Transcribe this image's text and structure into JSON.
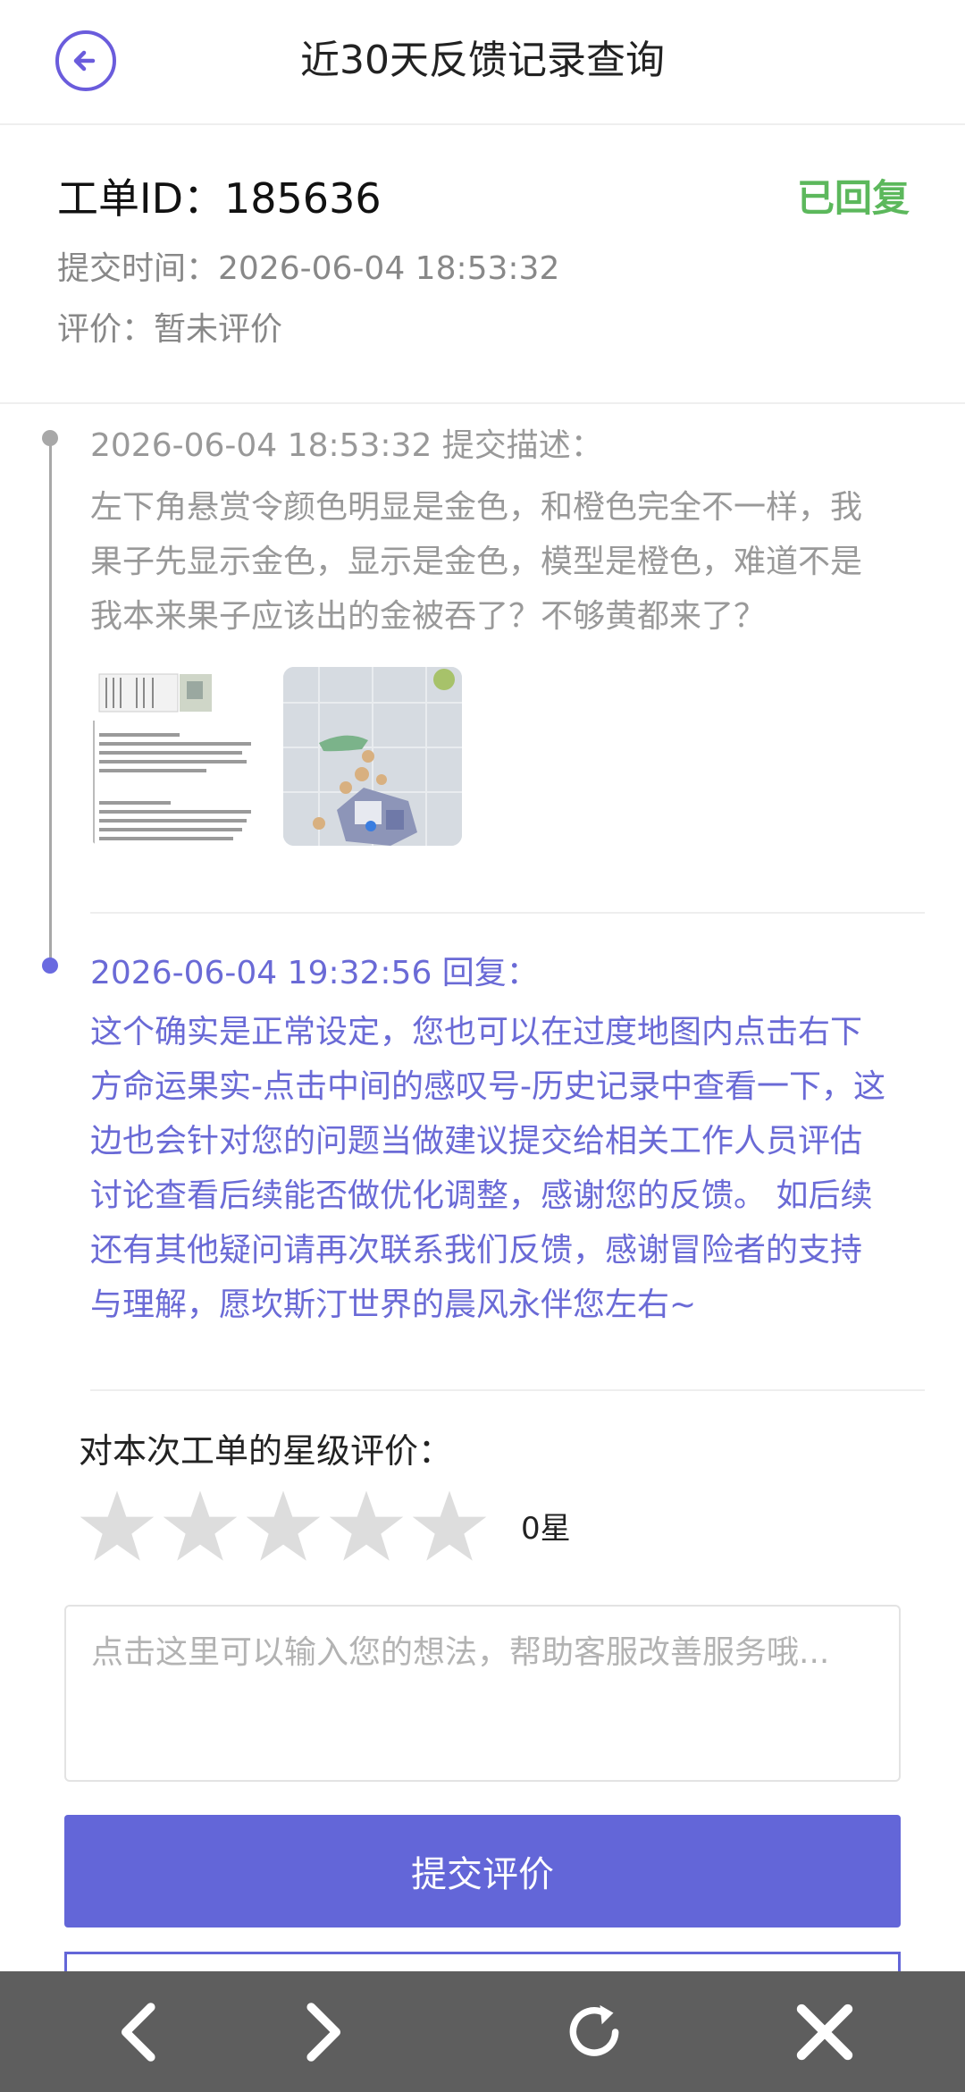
{
  "header": {
    "title": "近30天反馈记录查询"
  },
  "ticket": {
    "id_label": "工单ID：",
    "id_value": "185636",
    "status": "已回复",
    "time_label": "提交时间：",
    "time_value": "2026-06-04 18:53:32",
    "rating_label": "评价：",
    "rating_value": "暂未评价"
  },
  "timeline": {
    "submit": {
      "head": "2026-06-04 18:53:32 提交描述：",
      "lines": [
        "左下角悬赏令颜色明显是金色，和橙色完全不一样，我",
        "果子先显示金色，显示是金色，模型是橙色，难道不是",
        "我本来果子应该出的金被吞了？不够黄都来了？"
      ]
    },
    "reply": {
      "head": "2026-06-04 19:32:56 回复：",
      "lines": [
        "这个确实是正常设定，您也可以在过度地图内点击右下",
        "方命运果实-点击中间的感叹号-历史记录中查看一下，这",
        "边也会针对您的问题当做建议提交给相关工作人员评估",
        "讨论查看后续能否做优化调整，感谢您的反馈。 如后续",
        "还有其他疑问请再次联系我们反馈，感谢冒险者的支持",
        "与理解，愿坎斯汀世界的晨风永伴您左右~"
      ]
    }
  },
  "rating": {
    "label": "对本次工单的星级评价：",
    "stars": 0,
    "max_stars": 5,
    "count_text": "0星",
    "star_color": "#dddddd"
  },
  "feedback": {
    "placeholder": "点击这里可以输入您的想法，帮助客服改善服务哦..."
  },
  "submit": {
    "label": "提交评价"
  },
  "colors": {
    "accent": "#6366d8",
    "status_green": "#5cb85c",
    "nav_bg": "#5e5e5e"
  },
  "nav": {
    "icons": [
      "back-arrow-icon",
      "forward-arrow-icon",
      "refresh-icon",
      "close-icon"
    ]
  }
}
